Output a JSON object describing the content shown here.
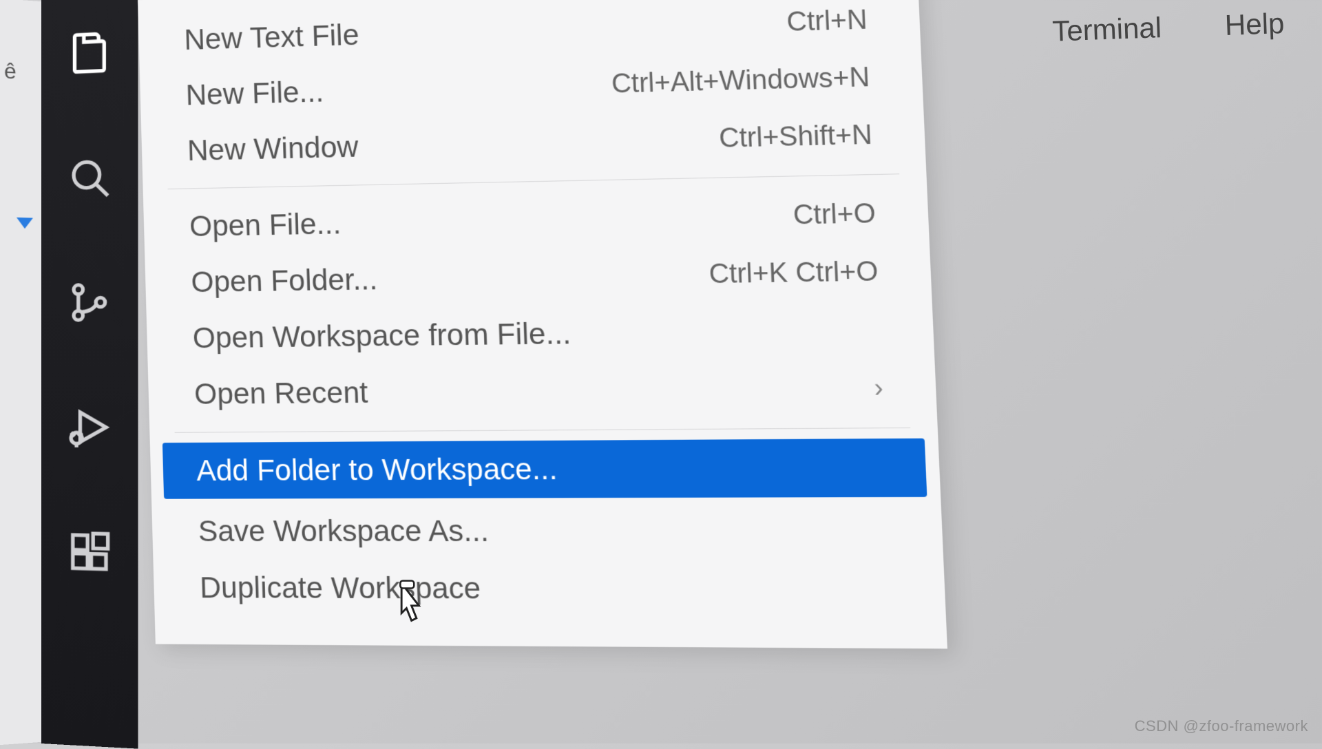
{
  "menubar": {
    "terminal": "Terminal",
    "help": "Help"
  },
  "file_menu": {
    "section1": [
      {
        "label": "New Text File",
        "shortcut": "Ctrl+N"
      },
      {
        "label": "New File...",
        "shortcut": "Ctrl+Alt+Windows+N"
      },
      {
        "label": "New Window",
        "shortcut": "Ctrl+Shift+N"
      }
    ],
    "section2": [
      {
        "label": "Open File...",
        "shortcut": "Ctrl+O"
      },
      {
        "label": "Open Folder...",
        "shortcut": "Ctrl+K Ctrl+O"
      },
      {
        "label": "Open Workspace from File...",
        "shortcut": ""
      },
      {
        "label": "Open Recent",
        "shortcut": "",
        "submenu": true
      }
    ],
    "section3": [
      {
        "label": "Add Folder to Workspace...",
        "shortcut": "",
        "selected": true
      },
      {
        "label": "Save Workspace As...",
        "shortcut": ""
      },
      {
        "label": "Duplicate Workspace",
        "shortcut": ""
      }
    ]
  },
  "activity_bar": {
    "items": [
      "explorer",
      "search",
      "source-control",
      "run-debug",
      "extensions"
    ]
  },
  "watermark": "CSDN @zfoo-framework"
}
